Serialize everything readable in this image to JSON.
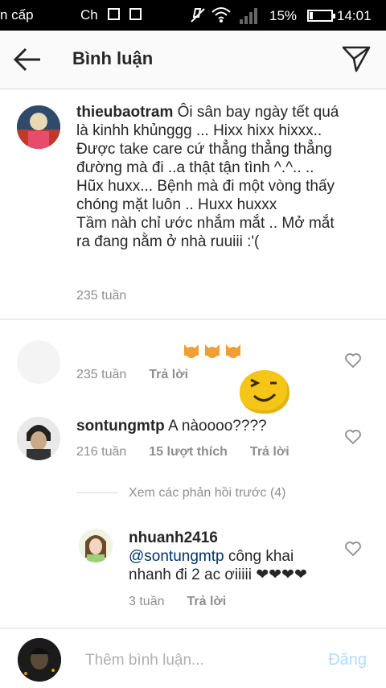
{
  "status_bar": {
    "carrier_left": "n cấp",
    "carrier_right": "Ch",
    "battery": "15%",
    "time": "14:01"
  },
  "header": {
    "title": "Bình luận"
  },
  "comments": [
    {
      "username": "thieubaotram",
      "text": "Ôi sân bay ngày tết quá là kinhh khủnggg ... Hixx hixx hixxx.. Được take care cứ thẳng thẳng thẳng đường mà đi ..a thật tận tình ^.^.. .. Hũx huxx... Bệnh mà đi một vòng thấy chóng mặt luôn .. Huxx huxxx",
      "text2": "Tầm nàh chỉ ước nhắm mắt .. Mở mắt ra đang nằm ở nhà ruuiii :'(",
      "time": "235 tuần"
    },
    {
      "username": "",
      "text": "",
      "time": "235 tuần",
      "reply": "Trả lời"
    },
    {
      "username": "sontungmtp",
      "text": "A nàoooo????",
      "time": "216 tuần",
      "likes": "15 lượt thích",
      "reply": "Trả lời"
    }
  ],
  "view_previous": "Xem các phản hồi trước (4)",
  "replies": [
    {
      "username": "nhuanh2416",
      "mention": "@sontungmtp",
      "text": " công khai nhanh đi 2 ac ơiiiii ❤❤❤❤",
      "time": "3 tuần",
      "reply": "Trả lời"
    }
  ],
  "footer": {
    "placeholder": "Thêm bình luận...",
    "post_label": "Đăng"
  },
  "colors": {
    "post_disabled": "#b3dbff",
    "secondary_text": "#8e8e8e",
    "primary_text": "#262626",
    "mention": "#003569"
  }
}
